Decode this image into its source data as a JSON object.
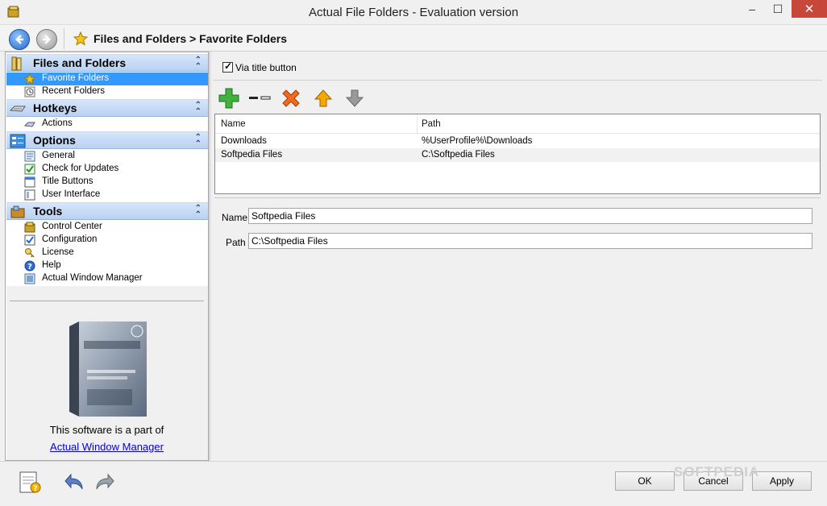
{
  "window": {
    "title": "Actual File Folders - Evaluation version",
    "minimize_icon": "minimize-icon",
    "maximize_icon": "maximize-icon",
    "close_icon": "close-icon"
  },
  "nav": {
    "breadcrumb": "Files and Folders > Favorite Folders"
  },
  "sidebar": {
    "groups": [
      {
        "label": "Files and Folders",
        "icon": "files-folders-icon",
        "items": [
          {
            "label": "Favorite Folders",
            "icon": "star-icon"
          },
          {
            "label": "Recent Folders",
            "icon": "clock-icon"
          }
        ]
      },
      {
        "label": "Hotkeys",
        "icon": "keyboard-icon",
        "items": [
          {
            "label": "Actions",
            "icon": "actions-icon"
          }
        ]
      },
      {
        "label": "Options",
        "icon": "options-icon",
        "items": [
          {
            "label": "General",
            "icon": "general-icon"
          },
          {
            "label": "Check for Updates",
            "icon": "updates-icon"
          },
          {
            "label": "Title Buttons",
            "icon": "title-buttons-icon"
          },
          {
            "label": "User Interface",
            "icon": "user-interface-icon"
          }
        ]
      },
      {
        "label": "Tools",
        "icon": "tools-icon",
        "items": [
          {
            "label": "Control Center",
            "icon": "control-center-icon"
          },
          {
            "label": "Configuration",
            "icon": "configuration-icon"
          },
          {
            "label": "License",
            "icon": "license-icon"
          },
          {
            "label": "Help",
            "icon": "help-icon"
          },
          {
            "label": "Actual Window Manager",
            "icon": "window-manager-icon"
          }
        ]
      }
    ],
    "promo_text": "This software is a part of",
    "promo_link": "Actual Window Manager"
  },
  "main": {
    "via_title_button": "Via title button",
    "columns": [
      "Name",
      "Path"
    ],
    "rows": [
      {
        "name": "Downloads",
        "path": "%UserProfile%\\Downloads"
      },
      {
        "name": "Softpedia Files",
        "path": "C:\\Softpedia Files"
      }
    ],
    "name_label": "Name",
    "name_value": "Softpedia Files",
    "path_label": "Path",
    "path_value": "C:\\Softpedia Files"
  },
  "footer": {
    "ok": "OK",
    "cancel": "Cancel",
    "apply": "Apply",
    "watermark": "SOFTPEDIA"
  },
  "colors": {
    "selection": "#3399ff",
    "group_header": "#c7dbf5",
    "close_button": "#c7473a"
  }
}
